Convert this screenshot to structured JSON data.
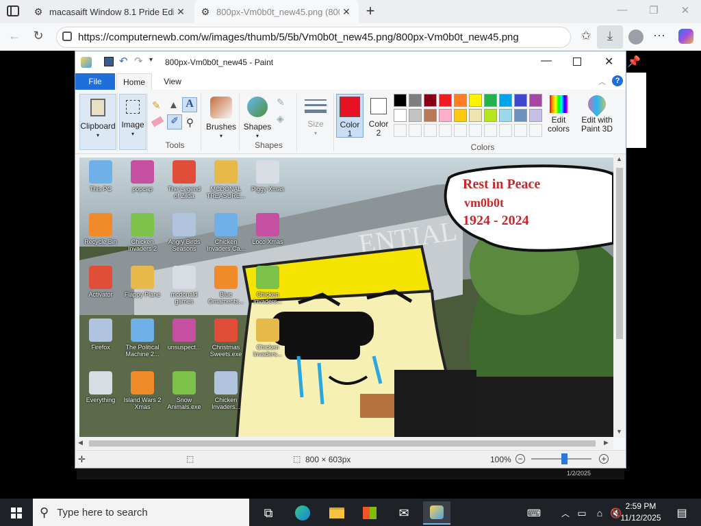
{
  "browser": {
    "tabs": [
      {
        "title": "macasaift Window 8.1 Pride Editic"
      },
      {
        "title": "800px-Vm0b0t_new45.png (800"
      }
    ],
    "url": "https://computernewb.com/w/images/thumb/5/5b/Vm0b0t_new45.png/800px-Vm0b0t_new45.png"
  },
  "paint": {
    "title": "800px-Vm0b0t_new45 - Paint",
    "tabs": {
      "file": "File",
      "home": "Home",
      "view": "View"
    },
    "groups": {
      "clipboard": "Clipboard",
      "image": "Image",
      "tools": "Tools",
      "brushes": "Brushes",
      "shapes_btn": "Shapes",
      "shapes": "Shapes",
      "size": "Size",
      "color1_a": "Color",
      "color1_b": "1",
      "color2_a": "Color",
      "color2_b": "2",
      "edit_colors_a": "Edit",
      "edit_colors_b": "colors",
      "paint3d_a": "Edit with",
      "paint3d_b": "Paint 3D",
      "colors": "Colors"
    },
    "colors": {
      "color1": "#e81123",
      "color2": "#ffffff",
      "palette_row1": [
        "#000000",
        "#7f7f7f",
        "#880015",
        "#ed1c24",
        "#ff7f27",
        "#fff200",
        "#22b14c",
        "#00a2e8",
        "#3f48cc",
        "#a349a4"
      ],
      "palette_row2": [
        "#ffffff",
        "#c3c3c3",
        "#b97a57",
        "#ffaec9",
        "#ffc90e",
        "#efe4b0",
        "#b5e61d",
        "#99d9ea",
        "#7092be",
        "#c8bfe7"
      ]
    },
    "status": {
      "size": "800 × 603px",
      "zoom": "100%",
      "zoom_fraction": 0.55
    },
    "canvas": {
      "bubble_line1": "Rest in Peace",
      "bubble_line2": "vm0b0t",
      "bubble_line3": "1924 - 2024",
      "sign_text": "ENTIAL",
      "desktop_icons": [
        "This PC",
        "popcap",
        "The Legend of Zilda",
        "MCDONAL TREASURE...",
        "Piggy Xmas",
        "Recycle Bin",
        "Chicken Invaders 2",
        "Angry Birds Seasons",
        "Chicken Invaders Ca...",
        "Loco Xmas",
        "Activator",
        "Flappy Plane",
        "mcdonald games",
        "Blue Ornaments...",
        "Chicken Invaders...",
        "Firefox",
        "The Political Machine 2...",
        "unsuspect...",
        "Christmas Sweets.exe",
        "Chicken Invaders...",
        "Everything",
        "Island Wars 2 Xmas",
        "Snow Animals.exe",
        "Chicken Invaders..."
      ],
      "inner_date": "1/2/2025"
    }
  },
  "taskbar": {
    "search_placeholder": "Type here to search",
    "time": "2:59 PM",
    "date": "11/12/2025"
  }
}
